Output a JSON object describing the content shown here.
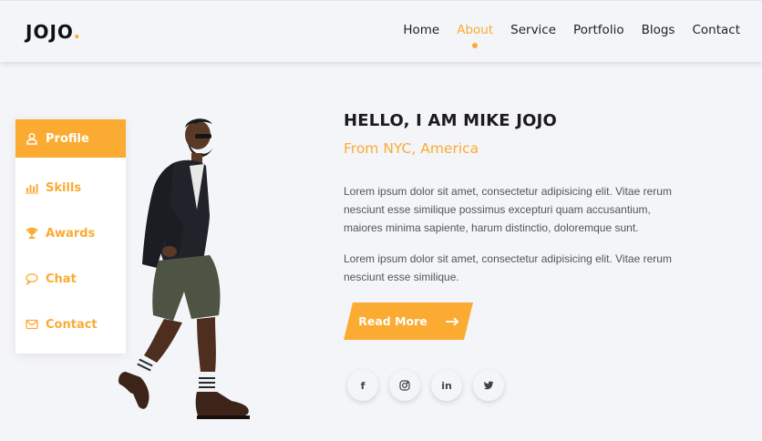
{
  "header": {
    "logo_text": "JOJO",
    "logo_dot": ".",
    "nav": [
      {
        "label": "Home",
        "active": false
      },
      {
        "label": "About",
        "active": true
      },
      {
        "label": "Service",
        "active": false
      },
      {
        "label": "Portfolio",
        "active": false
      },
      {
        "label": "Blogs",
        "active": false
      },
      {
        "label": "Contact",
        "active": false
      }
    ]
  },
  "side_menu": {
    "items": [
      {
        "label": "Profile",
        "icon": "user-icon",
        "active": true
      },
      {
        "label": "Skills",
        "icon": "bar-chart-icon",
        "active": false
      },
      {
        "label": "Awards",
        "icon": "trophy-icon",
        "active": false
      },
      {
        "label": "Chat",
        "icon": "chat-icon",
        "active": false
      },
      {
        "label": "Contact",
        "icon": "envelope-icon",
        "active": false
      }
    ]
  },
  "about": {
    "heading": "HELLO, I AM MIKE JOJO",
    "subheading": "From NYC, America",
    "paragraph1": "Lorem ipsum dolor sit amet, consectetur adipisicing elit. Vitae rerum nesciunt esse similique possimus excepturi quam accusantium, maiores minima sapiente, harum distinctio, doloremque sunt.",
    "paragraph2": "Lorem ipsum dolor sit amet, consectetur adipisicing elit. Vitae rerum nesciunt esse similique.",
    "read_more_label": "Read More"
  },
  "socials": [
    {
      "label": "f",
      "icon": "facebook-icon"
    },
    {
      "label": "instagram",
      "icon": "instagram-icon"
    },
    {
      "label": "in",
      "icon": "linkedin-icon"
    },
    {
      "label": "twitter",
      "icon": "twitter-icon"
    }
  ],
  "colors": {
    "accent": "#fbab31",
    "background": "#f4f5f9"
  }
}
